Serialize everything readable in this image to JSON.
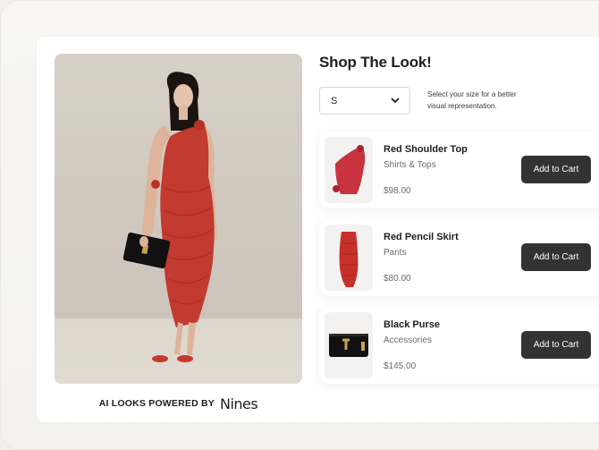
{
  "title": "Shop The Look!",
  "size_select": {
    "value": "S",
    "hint": "Select your size for a better visual representation."
  },
  "powered_by": {
    "text": "AI LOOKS POWERED BY",
    "brand": "Nines"
  },
  "products": [
    {
      "name": "Red Shoulder Top",
      "category": "Shirts & Tops",
      "price": "$98.00",
      "button": "Add to Cart"
    },
    {
      "name": "Red Pencil Skirt",
      "category": "Pants",
      "price": "$80.00",
      "button": "Add to Cart"
    },
    {
      "name": "Black Purse",
      "category": "Accessories",
      "price": "$145.00",
      "button": "Add to Cart"
    }
  ],
  "colors": {
    "dress": "#c23a30",
    "button": "#333333",
    "purse": "#111111",
    "gold": "#c9a24c"
  }
}
